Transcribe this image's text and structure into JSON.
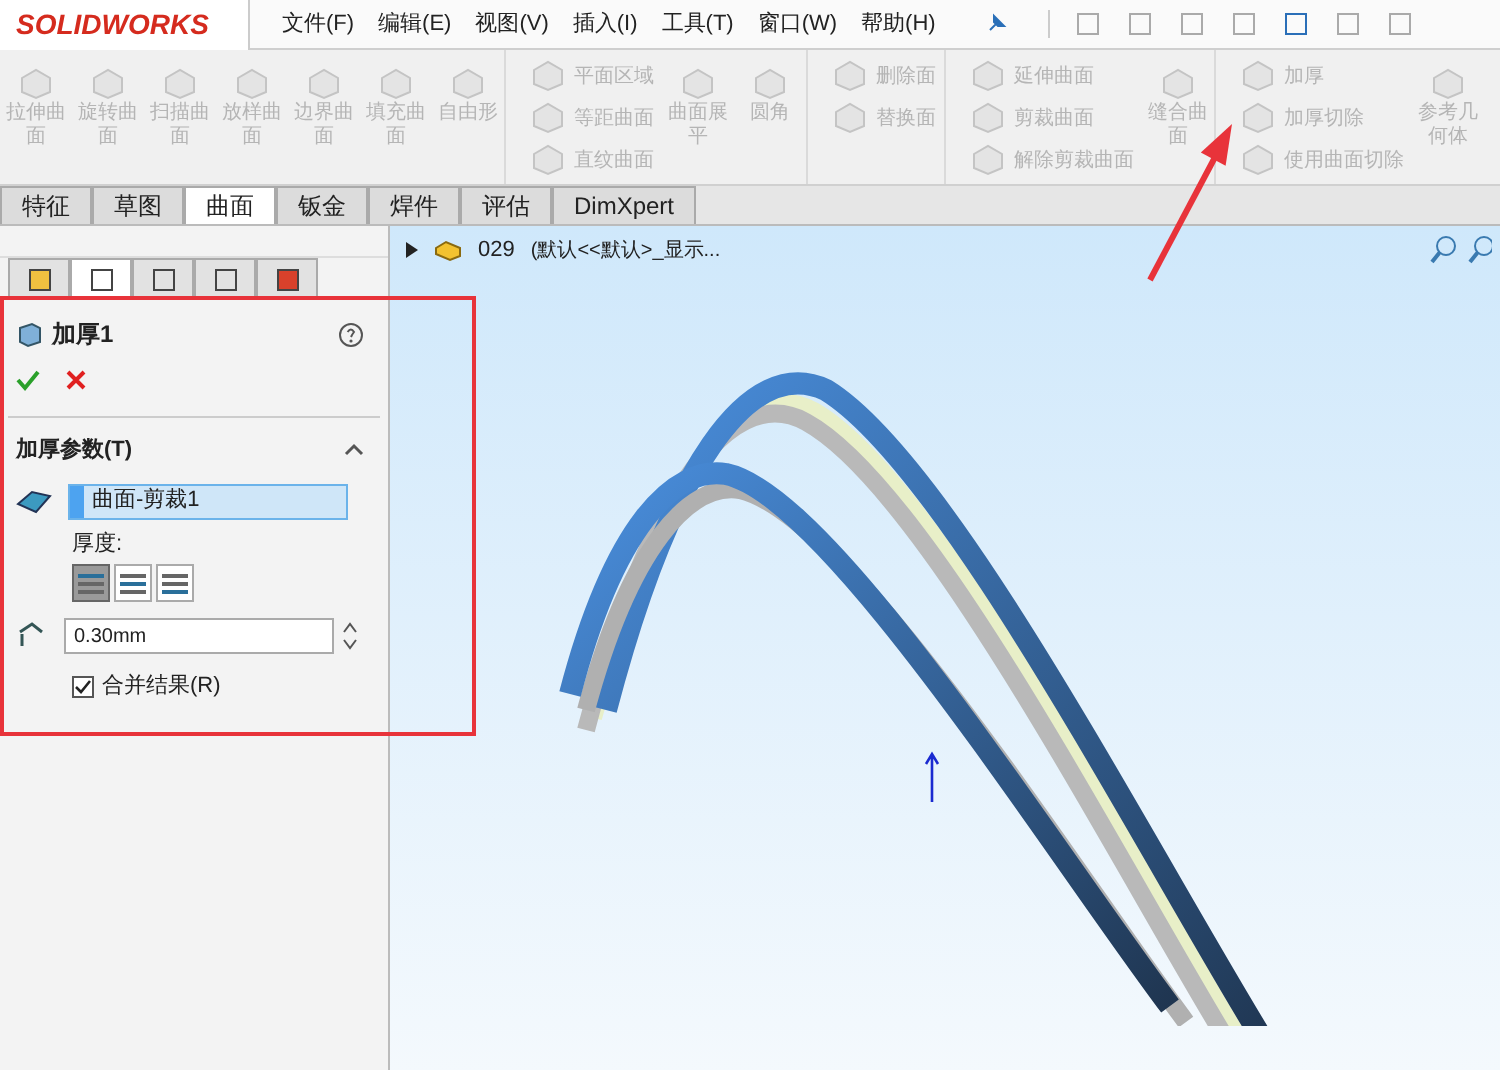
{
  "app": {
    "logo": "SOLIDWORKS"
  },
  "menu": [
    "文件(F)",
    "编辑(E)",
    "视图(V)",
    "插入(I)",
    "工具(T)",
    "窗口(W)",
    "帮助(H)"
  ],
  "ribbon": [
    {
      "kind": "big",
      "label": "拉伸曲面",
      "disabled": true
    },
    {
      "kind": "big",
      "label": "旋转曲面",
      "disabled": true
    },
    {
      "kind": "big",
      "label": "扫描曲面",
      "disabled": true
    },
    {
      "kind": "big",
      "label": "放样曲面",
      "disabled": true
    },
    {
      "kind": "big",
      "label": "边界曲面",
      "disabled": true
    },
    {
      "kind": "big",
      "label": "填充曲面",
      "disabled": true
    },
    {
      "kind": "big",
      "label": "自由形",
      "disabled": true
    },
    {
      "kind": "stack",
      "items": [
        {
          "label": "平面区域",
          "disabled": true
        },
        {
          "label": "等距曲面",
          "disabled": true
        },
        {
          "label": "直纹曲面",
          "disabled": true
        }
      ]
    },
    {
      "kind": "big",
      "label": "曲面展平",
      "disabled": true
    },
    {
      "kind": "big",
      "label": "圆角",
      "disabled": true
    },
    {
      "kind": "stack",
      "items": [
        {
          "label": "删除面",
          "disabled": true
        },
        {
          "label": "替换面",
          "disabled": true
        }
      ]
    },
    {
      "kind": "stack",
      "items": [
        {
          "label": "延伸曲面",
          "disabled": true
        },
        {
          "label": "剪裁曲面",
          "disabled": true
        },
        {
          "label": "解除剪裁曲面",
          "disabled": true
        }
      ]
    },
    {
      "kind": "big",
      "label": "缝合曲面",
      "disabled": true
    },
    {
      "kind": "stack",
      "items": [
        {
          "label": "加厚",
          "disabled": true
        },
        {
          "label": "加厚切除",
          "disabled": true
        },
        {
          "label": "使用曲面切除",
          "disabled": true
        }
      ]
    },
    {
      "kind": "big",
      "label": "参考几何体",
      "disabled": true
    }
  ],
  "tabs": [
    {
      "label": "特征",
      "selected": false
    },
    {
      "label": "草图",
      "selected": false
    },
    {
      "label": "曲面",
      "selected": true
    },
    {
      "label": "钣金",
      "selected": false
    },
    {
      "label": "焊件",
      "selected": false
    },
    {
      "label": "评估",
      "selected": false
    },
    {
      "label": "DimXpert",
      "selected": false
    }
  ],
  "panel_tabs": [
    {
      "selected": false
    },
    {
      "selected": true
    },
    {
      "selected": false
    },
    {
      "selected": false
    },
    {
      "selected": false
    }
  ],
  "tree": {
    "expanded": false,
    "name": "029",
    "config": "(默认<<默认>_显示..."
  },
  "property_manager": {
    "title": "加厚1",
    "section": {
      "title": "加厚参数(T)",
      "expanded": true
    },
    "selection": "曲面-剪裁1",
    "thickness_label": "厚度:",
    "sides": [
      {
        "selected": true
      },
      {
        "selected": false
      },
      {
        "selected": false
      }
    ],
    "thickness": "0.30mm",
    "merge": {
      "label": "合并结果(R)",
      "checked": true
    }
  }
}
